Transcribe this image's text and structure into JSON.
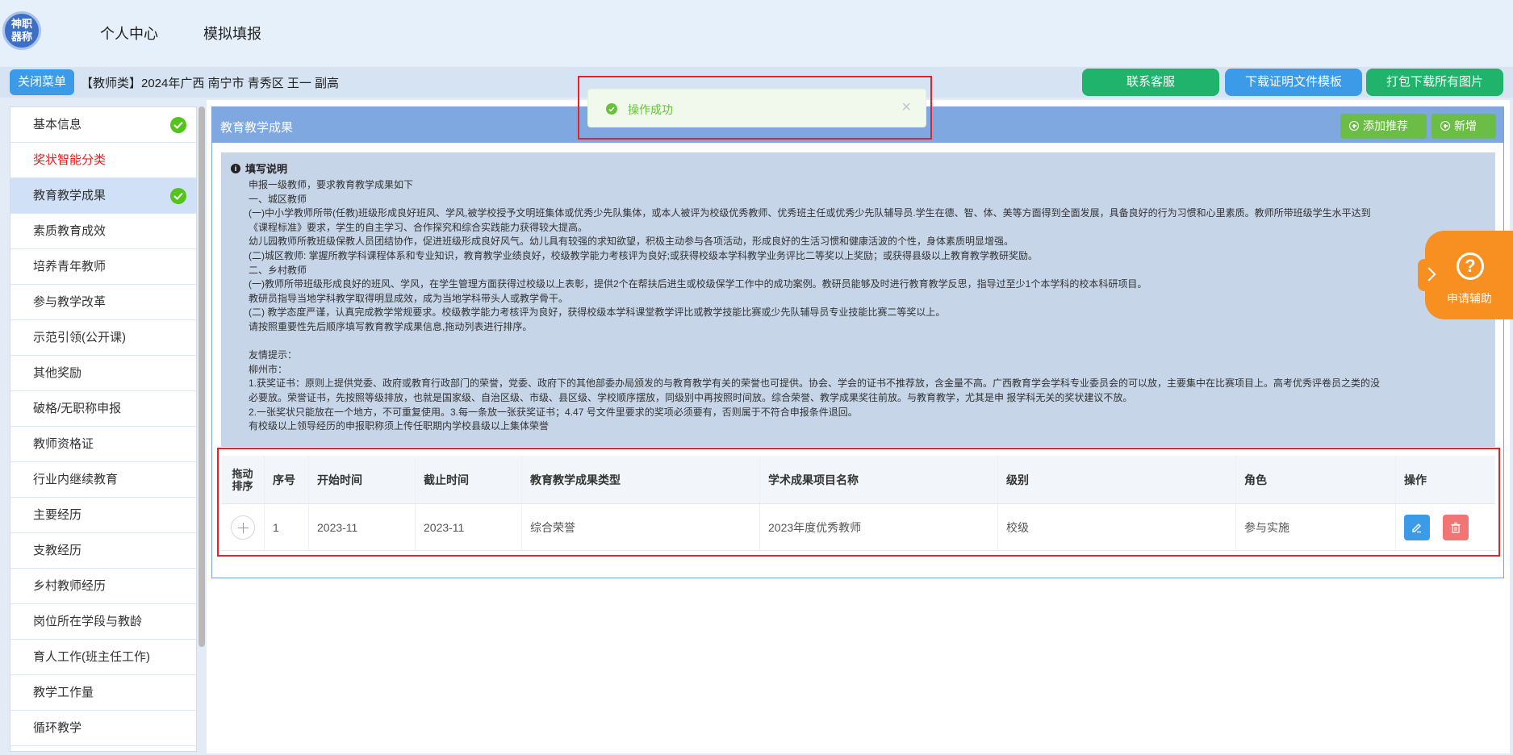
{
  "header": {
    "logo_text": "神职\n器称",
    "nav": [
      "个人中心",
      "模拟填报"
    ]
  },
  "infobar": {
    "close_menu": "关闭菜单",
    "info": "【教师类】2024年广西 南宁市 青秀区 王一 副高",
    "contact": "联系客服",
    "template": "下载证明文件模板",
    "pack": "打包下载所有图片"
  },
  "sidebar": {
    "items": [
      {
        "label": "基本信息",
        "checked": true
      },
      {
        "label": "奖状智能分类",
        "highlight": true
      },
      {
        "label": "教育教学成果",
        "checked": true,
        "active": true
      },
      {
        "label": "素质教育成效"
      },
      {
        "label": "培养青年教师"
      },
      {
        "label": "参与教学改革"
      },
      {
        "label": "示范引领(公开课)"
      },
      {
        "label": "其他奖励"
      },
      {
        "label": "破格/无职称申报"
      },
      {
        "label": "教师资格证"
      },
      {
        "label": "行业内继续教育"
      },
      {
        "label": "主要经历"
      },
      {
        "label": "支教经历"
      },
      {
        "label": "乡村教师经历"
      },
      {
        "label": "岗位所在学段与教龄"
      },
      {
        "label": "育人工作(班主任工作)"
      },
      {
        "label": "教学工作量"
      },
      {
        "label": "循环教学"
      }
    ]
  },
  "card": {
    "title": "教育教学成果",
    "recommend": "添加推荐",
    "add": "新增"
  },
  "notice": {
    "title": "填写说明",
    "lines": [
      "申报一级教师，要求教育教学成果如下",
      "一、城区教师",
      "(一)中小学教师所带(任教)班级形成良好班风、学风,被学校授予文明班集体或优秀少先队集体，或本人被评为校级优秀教师、优秀班主任或优秀少先队辅导员.学生在德、智、体、美等方面得到全面发展，具备良好的行为习惯和心里素质。教师所带班级学生水平达到",
      "《课程标准》要求，学生的自主学习、合作探究和综合实践能力获得较大提高。",
      "幼儿园教师所教班级保教人员团结协作，促进班级形成良好风气。幼儿具有较强的求知欲望，积极主动参与各项活动，形成良好的生活习惯和健康活波的个性，身体素质明显增强。",
      "(二)城区教师: 掌握所教学科课程体系和专业知识，教育教学业绩良好，校级教学能力考核评为良好;或获得校级本学科教学业务评比二等奖以上奖励；或获得县级以上教育教学教研奖励。",
      "二、乡村教师",
      "(一)教师所带班级形成良好的班风、学风，在学生管理方面获得过校级以上表彰，提供2个在帮扶后进生或校级保学工作中的成功案例。教研员能够及时进行教育教学反思，指导过至少1个本学科的校本科研项目。",
      "教研员指导当地学科教学取得明显成效，成为当地学科带头人或教学骨干。",
      "(二) 教学态度严谨，认真完成教学常规要求。校级教学能力考核评为良好，获得校级本学科课堂教学评比或教学技能比赛或少先队辅导员专业技能比赛二等奖以上。",
      "请按照重要性先后顺序填写教育教学成果信息,拖动列表进行排序。",
      "",
      "友情提示：",
      "柳州市：",
      "1.获奖证书：原则上提供党委、政府或教育行政部门的荣誉，党委、政府下的其他部委办局颁发的与教育教学有关的荣誉也可提供。协会、学会的证书不推荐放，含金量不高。广西教育学会学科专业委员会的可以放，主要集中在比赛项目上。高考优秀评卷员之类的没",
      "必要放。荣誉证书，先按照等级排放，也就是国家级、自治区级、市级、县区级、学校顺序摆放，同级别中再按照时间放。综合荣誉、教学成果奖往前放。与教育教学，尤其是申 报学科无关的奖状建议不放。",
      "2.一张奖状只能放在一个地方，不可重复使用。3.每一条放一张获奖证书；4.47 号文件里要求的奖项必须要有，否则属于不符合申报条件退回。",
      "有校级以上领导经历的申报职称须上传任职期内学校县级以上集体荣誉"
    ]
  },
  "table": {
    "headers": [
      "拖动\n排序",
      "序号",
      "开始时间",
      "截止时间",
      "教育教学成果类型",
      "学术成果项目名称",
      "级别",
      "角色",
      "操作"
    ],
    "rows": [
      {
        "index": "1",
        "start": "2023-11",
        "end": "2023-11",
        "type": "综合荣誉",
        "name": "2023年度优秀教师",
        "level": "校级",
        "role": "参与实施"
      }
    ]
  },
  "toast": {
    "message": "操作成功"
  },
  "help": {
    "label": "申请辅助"
  },
  "colors": {
    "primary": "#3c9be8",
    "green": "#1fb36b",
    "header_blue": "#7fa8e0",
    "success": "#67c23a",
    "danger": "#f27474",
    "help_orange": "#f79020",
    "highlight_red": "#e8202a"
  }
}
